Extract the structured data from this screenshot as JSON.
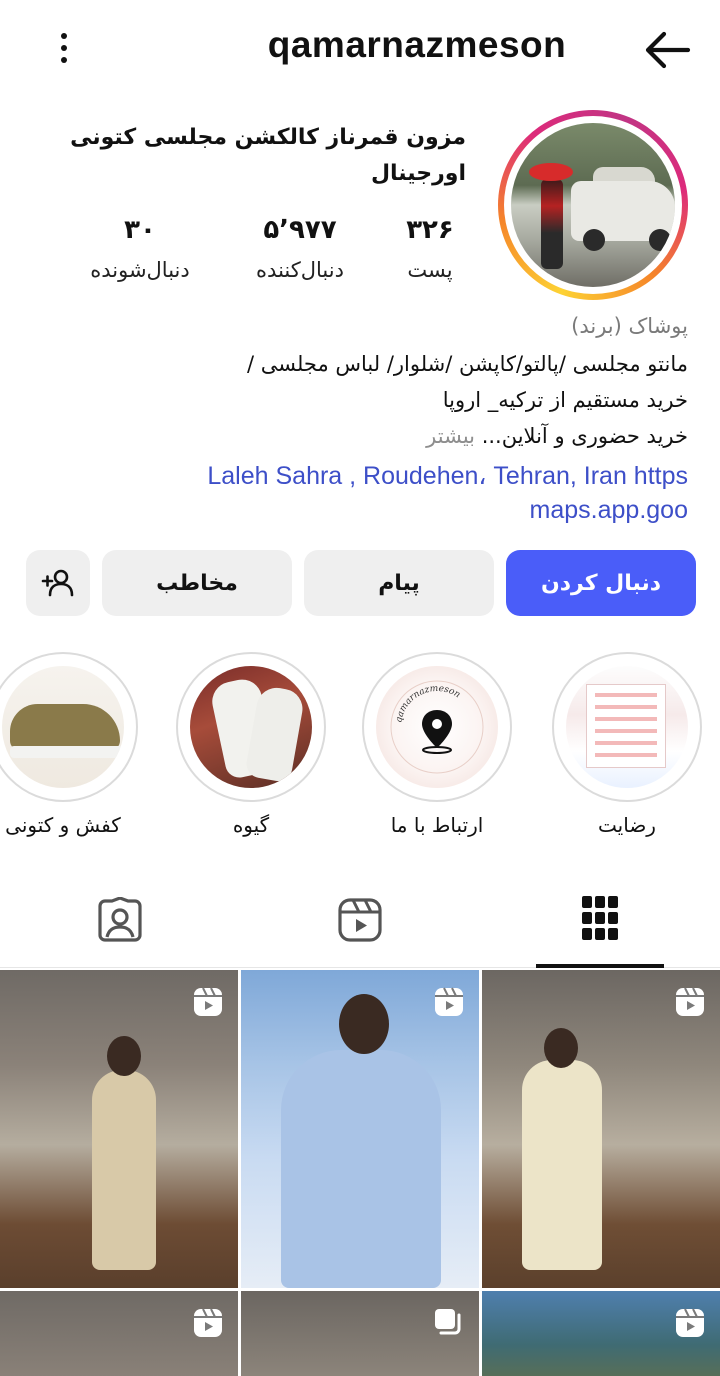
{
  "header": {
    "username": "qamarnazmeson",
    "back_icon": "arrow-left-icon",
    "menu_icon": "more-vertical-icon"
  },
  "profile": {
    "name": "مزون قمرناز کالکشن مجلسی  کتونی اورجینال",
    "stats": {
      "posts_value": "۳۲۶",
      "posts_label": "پست",
      "followers_value": "۵٬۹۷۷",
      "followers_label": "دنبال‌کننده",
      "following_value": "۳۰",
      "following_label": "دنبال‌شونده"
    },
    "category": "پوشاک (برند)",
    "bio_line_1": "مانتو مجلسی /پالتو/کاپشن /شلوار/ لباس مجلسی /",
    "bio_line_2": "خرید مستقیم از ترکیه_ اروپا",
    "bio_line_3": "خرید حضوری و آنلاین...",
    "more_label": "بیشتر",
    "link_line_1": "Laleh Sahra , Roudehen، Tehran, Iran https",
    "link_line_2": "maps.app.goo"
  },
  "buttons": {
    "follow": "دنبال کردن",
    "message": "پیام",
    "contact": "مخاطب",
    "add_user_icon": "add-user-icon"
  },
  "highlights": [
    {
      "label": "رضایت"
    },
    {
      "label": "ارتباط با ما",
      "logo_text": "qamarnazmeson"
    },
    {
      "label": "گیوه"
    },
    {
      "label": "کفش و کتونی"
    }
  ],
  "tabs": {
    "grid_icon": "grid-icon",
    "reels_icon": "reels-icon",
    "tagged_icon": "tagged-icon"
  },
  "colors": {
    "follow_button": "#4a5df9",
    "link": "#3d4fc8",
    "secondary_text": "#7a7a7a",
    "button_bg": "#efefef"
  }
}
